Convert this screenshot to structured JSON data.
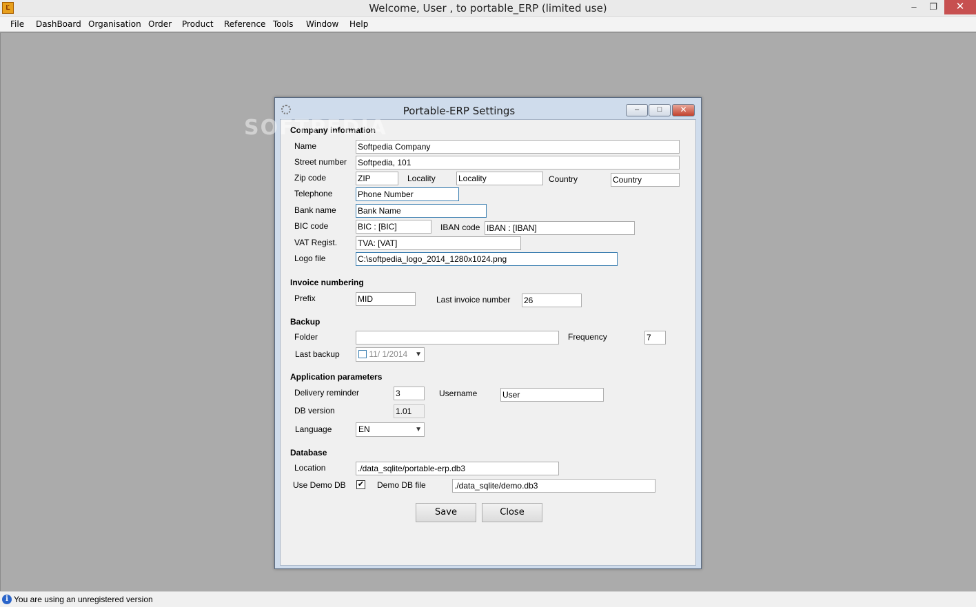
{
  "window": {
    "title": "Welcome, User , to portable_ERP (limited use)",
    "app_icon": "Ľ",
    "min_glyph": "‒",
    "max_glyph": "❐",
    "close_glyph": "✕"
  },
  "menu": [
    "File",
    "DashBoard",
    "Organisation",
    "Order",
    "Product",
    "Reference",
    "Tools",
    "Window",
    "Help"
  ],
  "watermark": "SOFTPEDIA",
  "dialog": {
    "title": "Portable-ERP Settings",
    "min_glyph": "–",
    "max_glyph": "□",
    "close_glyph": "✕",
    "company": {
      "section": "Company information",
      "name_label": "Name",
      "name_value": "Softpedia Company",
      "street_label": "Street  number",
      "street_value": "Softpedia, 101",
      "zip_label": "Zip code",
      "zip_value": "ZIP",
      "locality_label": "Locality",
      "locality_value": "Locality",
      "country_label": "Country",
      "country_value": "Country",
      "telephone_label": "Telephone",
      "telephone_value": "Phone Number",
      "bank_label": "Bank name",
      "bank_value": "Bank Name",
      "bic_label": "BIC code",
      "bic_value": "BIC : [BIC]",
      "iban_label": "IBAN code",
      "iban_value": "IBAN : [IBAN]",
      "vat_label": "VAT Regist.",
      "vat_value": "TVA: [VAT]",
      "logo_label": "Logo file",
      "logo_value": "C:\\softpedia_logo_2014_1280x1024.png"
    },
    "invoice": {
      "section": "Invoice numbering",
      "prefix_label": "Prefix",
      "prefix_value": "MID",
      "last_label": "Last invoice number",
      "last_value": "26"
    },
    "backup": {
      "section": "Backup",
      "folder_label": "Folder",
      "folder_value": "",
      "frequency_label": "Frequency",
      "frequency_value": "7",
      "last_label": "Last backup",
      "last_value": "11/  1/2014"
    },
    "app": {
      "section": "Application parameters",
      "delivery_label": "Delivery reminder",
      "delivery_value": "3",
      "username_label": "Username",
      "username_value": "User",
      "dbversion_label": "DB version",
      "dbversion_value": "1.01",
      "language_label": "Language",
      "language_value": "EN"
    },
    "database": {
      "section": "Database",
      "location_label": "Location",
      "location_value": "./data_sqlite/portable-erp.db3",
      "usedemo_label": "Use Demo DB",
      "usedemo_checked": true,
      "demofile_label": "Demo DB file",
      "demofile_value": "./data_sqlite/demo.db3"
    },
    "save_label": "Save",
    "close_label": "Close"
  },
  "status": {
    "icon": "i",
    "text": "You are using an unregistered version"
  }
}
